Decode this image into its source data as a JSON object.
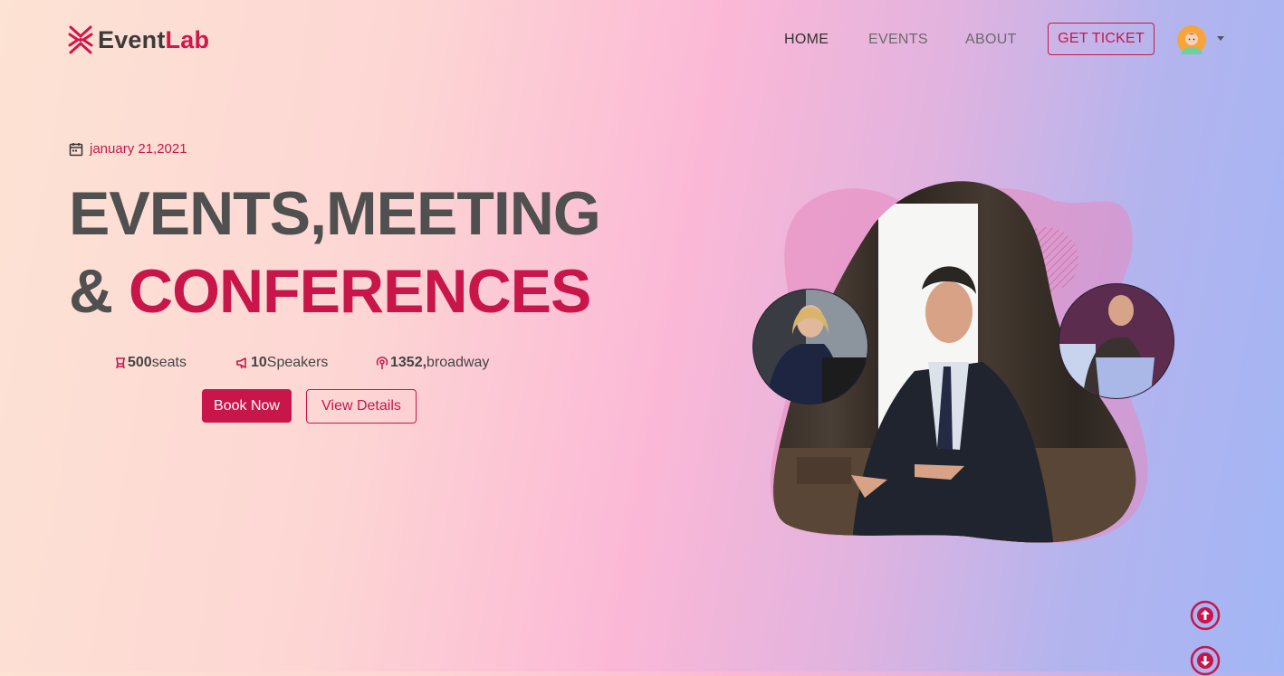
{
  "brand": {
    "name_part1": "Event",
    "name_part2": "Lab"
  },
  "nav": {
    "items": [
      {
        "label": "HOME",
        "active": true
      },
      {
        "label": "EVENTS",
        "active": false
      },
      {
        "label": "ABOUT",
        "active": false
      }
    ],
    "ticket_label": "GET TICKET"
  },
  "hero": {
    "date": "january 21,2021",
    "title_line1": "EVENTS,MEETING",
    "title_line2_prefix": "& ",
    "title_line2_highlight": "CONFERENCES",
    "stats": [
      {
        "icon": "seat-icon",
        "value": "500",
        "label": " seats"
      },
      {
        "icon": "megaphone-icon",
        "value": "10",
        "label": " Speakers"
      },
      {
        "icon": "location-icon",
        "value": "1352,",
        "label": " broadway"
      }
    ],
    "book_label": "Book Now",
    "details_label": "View Details"
  },
  "colors": {
    "accent": "#c8164a",
    "heading": "#505050"
  }
}
